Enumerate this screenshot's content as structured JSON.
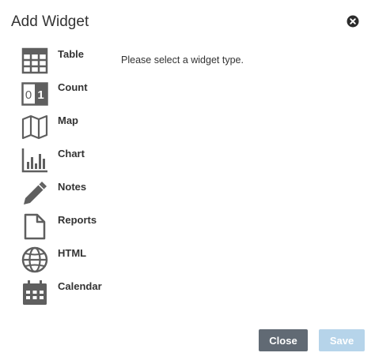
{
  "dialog": {
    "title": "Add Widget",
    "hint": "Please select a widget type."
  },
  "widget_types": [
    {
      "label": "Table",
      "icon": "table-icon"
    },
    {
      "label": "Count",
      "icon": "count-icon"
    },
    {
      "label": "Map",
      "icon": "map-icon"
    },
    {
      "label": "Chart",
      "icon": "bar-chart-icon"
    },
    {
      "label": "Notes",
      "icon": "pencil-icon"
    },
    {
      "label": "Reports",
      "icon": "document-icon"
    },
    {
      "label": "HTML",
      "icon": "globe-icon"
    },
    {
      "label": "Calendar",
      "icon": "calendar-icon"
    }
  ],
  "count_icon_digits": [
    "0",
    "1"
  ],
  "buttons": {
    "close_label": "Close",
    "save_label": "Save"
  },
  "colors": {
    "icon": "#5f5f5f",
    "close_button": "#616a74",
    "save_button_disabled": "#b6d4ea"
  }
}
